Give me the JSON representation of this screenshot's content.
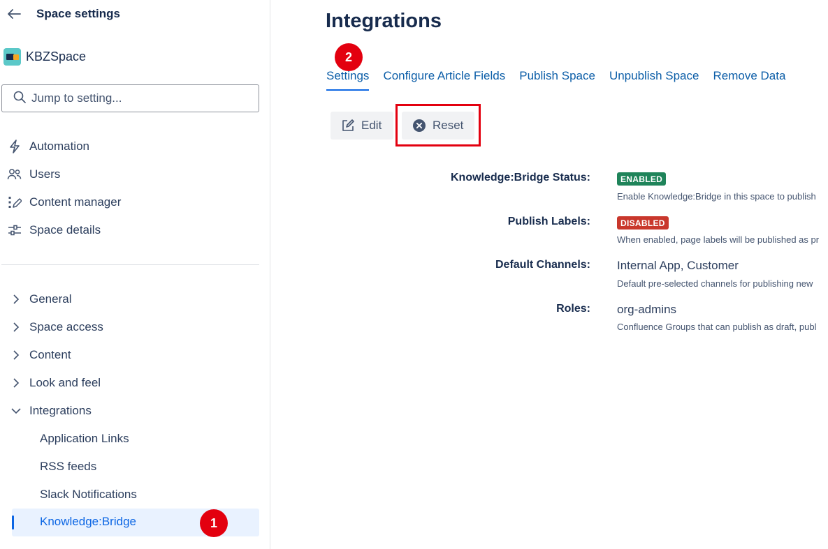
{
  "sidebar": {
    "title": "Space settings",
    "space_name": "KBZSpace",
    "search_placeholder": "Jump to setting...",
    "nav": [
      {
        "label": "Automation",
        "icon": "lightning-icon"
      },
      {
        "label": "Users",
        "icon": "users-icon"
      },
      {
        "label": "Content manager",
        "icon": "content-manager-icon"
      },
      {
        "label": "Space details",
        "icon": "sliders-icon"
      }
    ],
    "tree": [
      {
        "label": "General",
        "expanded": false
      },
      {
        "label": "Space access",
        "expanded": false
      },
      {
        "label": "Content",
        "expanded": false
      },
      {
        "label": "Look and feel",
        "expanded": false
      },
      {
        "label": "Integrations",
        "expanded": true
      }
    ],
    "sub_items": [
      "Application Links",
      "RSS feeds",
      "Slack Notifications"
    ],
    "active_sub_item": "Knowledge:Bridge"
  },
  "annotations": {
    "one": "1",
    "two": "2"
  },
  "main": {
    "title": "Integrations",
    "tabs": [
      {
        "label": "Settings",
        "active": true
      },
      {
        "label": "Configure Article Fields"
      },
      {
        "label": "Publish Space"
      },
      {
        "label": "Unpublish Space"
      },
      {
        "label": "Remove Data"
      }
    ],
    "edit_label": "Edit",
    "reset_label": "Reset",
    "fields": {
      "status": {
        "label": "Knowledge:Bridge Status:",
        "badge": "ENABLED",
        "desc": "Enable Knowledge:Bridge in this space to publish"
      },
      "labels": {
        "label": "Publish Labels:",
        "badge": "DISABLED",
        "desc": "When enabled, page labels will be published as pr"
      },
      "channels": {
        "label": "Default Channels:",
        "value": "Internal App, Customer",
        "desc": "Default pre-selected channels for publishing new"
      },
      "roles": {
        "label": "Roles:",
        "value": "org-admins",
        "desc": "Confluence Groups that can publish as draft, publ"
      }
    }
  },
  "colors": {
    "accent": "#0c66e4",
    "annotation": "#e3000f",
    "enabled": "#1f845a",
    "disabled": "#c9372c"
  }
}
